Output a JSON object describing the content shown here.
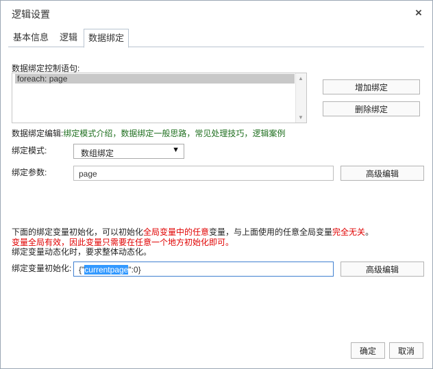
{
  "dialog": {
    "title": "逻辑设置",
    "close": "×"
  },
  "tabs": [
    {
      "label": "基本信息"
    },
    {
      "label": "逻辑"
    },
    {
      "label": "数据绑定",
      "active": true
    }
  ],
  "binding": {
    "control_label": "数据绑定控制语句:",
    "list_items": [
      "foreach: page"
    ],
    "add_button": "增加绑定",
    "delete_button": "删除绑定",
    "help_prefix": "数据绑定编辑:",
    "help_links": [
      "绑定模式介绍",
      "数据绑定一般思路",
      "常见处理技巧",
      "逻辑案例"
    ],
    "help_sep": "，",
    "mode_label": "绑定模式:",
    "mode_value": "数组绑定",
    "param_label": "绑定参数:",
    "param_value": "page",
    "advanced_edit": "高级编辑"
  },
  "notes": {
    "line1_a": "下面的绑定变量初始化，可以初始化",
    "line1_b": "全局变量中的任意",
    "line1_c": "变量，与上面使用的任意全局变量",
    "line1_d": "完全无关",
    "line1_e": "。",
    "line2": "变量全局有效，因此变量只需要在任意一个地方初始化即可。",
    "line3": "绑定变量动态化时，要求整体动态化。"
  },
  "init": {
    "label": "绑定变量初始化:",
    "value_prefix": "{\"",
    "value_selected": "currentpage",
    "value_suffix": "\":0}",
    "advanced_edit": "高级编辑"
  },
  "footer": {
    "ok": "确定",
    "cancel": "取消"
  },
  "colors": {
    "link": "#1f6f1f",
    "warning": "#e00000",
    "selection": "#3399ff",
    "focus_border": "#3f7fd0"
  }
}
